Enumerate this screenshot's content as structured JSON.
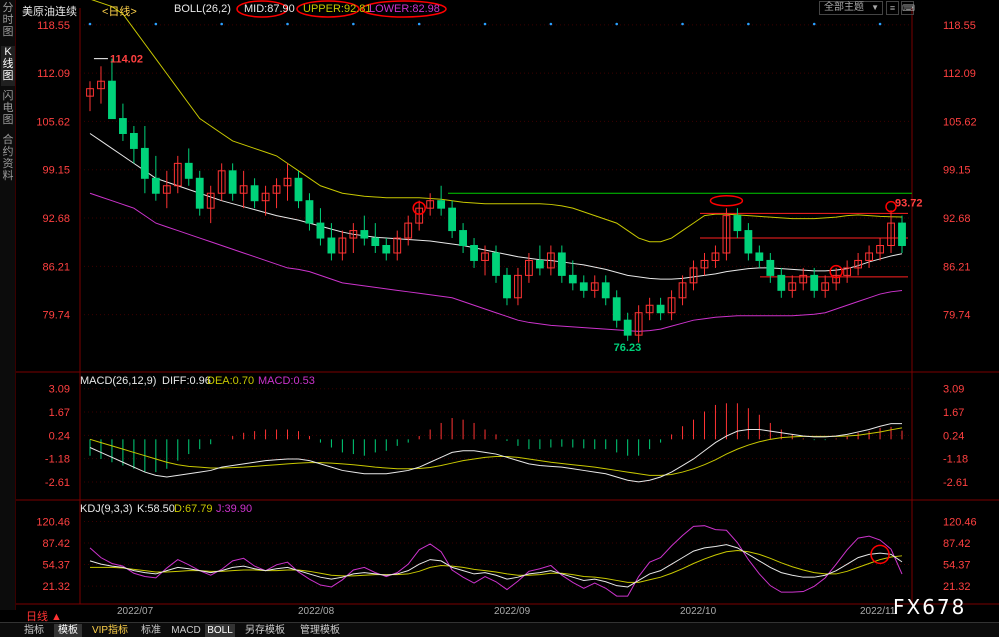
{
  "side_tabs": [
    {
      "label": "分时图",
      "active": false
    },
    {
      "label": "K线图",
      "active": true
    },
    {
      "label": "闪电图",
      "active": false
    },
    {
      "label": "合约资料",
      "active": false
    }
  ],
  "header": {
    "symbol": "美原油连续",
    "period_tag": "<日线>",
    "indicator": "BOLL(26,2)",
    "mid": "MID:87.90",
    "upper": "UPPER:92.81",
    "lower": "LOWER:82.98",
    "theme_select": "全部主题",
    "theme_arrow": "▼",
    "buttons": [
      "≡",
      "⌨"
    ]
  },
  "price_axis": [
    "118.55",
    "112.09",
    "105.62",
    "99.15",
    "92.68",
    "86.21",
    "79.74"
  ],
  "annotations": {
    "high": "114.02",
    "low": "76.23",
    "recent_high": "93.72"
  },
  "macd": {
    "title": "MACD(26,12,9)",
    "diff": "DIFF:0.96",
    "dea": "DEA:0.70",
    "macd": "MACD:0.53",
    "axis": [
      "3.09",
      "1.67",
      "0.24",
      "-1.18",
      "-2.61"
    ]
  },
  "kdj": {
    "title": "KDJ(9,3,3)",
    "k": "K:58.50",
    "d": "D:67.79",
    "j": "J:39.90",
    "axis": [
      "120.46",
      "87.42",
      "54.37",
      "21.32"
    ]
  },
  "dates": [
    "2022/07",
    "2022/08",
    "2022/09",
    "2022/10",
    "2022/11"
  ],
  "period_selector": "日线 ▲",
  "bottom_tabs": [
    {
      "label": "指标",
      "active": false
    },
    {
      "label": "模板",
      "active": true
    },
    {
      "label": "VIP指标",
      "active": false
    },
    {
      "label": "标准",
      "active": false
    },
    {
      "label": "MACD",
      "active": false
    },
    {
      "label": "BOLL",
      "active": true
    },
    {
      "label": "另存模板",
      "active": false
    },
    {
      "label": "管理模板",
      "active": false
    }
  ],
  "watermark": "FX678",
  "colors": {
    "up": "#ff3333",
    "down": "#00d27a",
    "mid": "#e8e8e8",
    "upper": "#c8c800",
    "lower": "#cc33cc",
    "dea": "#c8c800",
    "j": "#cc33cc"
  },
  "chart_data": {
    "type": "candlestick",
    "series": [
      {
        "name": "OHLC",
        "values": [
          [
            109,
            111,
            107,
            110
          ],
          [
            110,
            113,
            108,
            111
          ],
          [
            111,
            114.02,
            108,
            106
          ],
          [
            106,
            108,
            103,
            104
          ],
          [
            104,
            105,
            100,
            102
          ],
          [
            102,
            105,
            96,
            98
          ],
          [
            98,
            101,
            95,
            96
          ],
          [
            96,
            99,
            94,
            97
          ],
          [
            97,
            101,
            96,
            100
          ],
          [
            100,
            102,
            97,
            98
          ],
          [
            98,
            99,
            93,
            94
          ],
          [
            94,
            97,
            92,
            96
          ],
          [
            96,
            100,
            95,
            99
          ],
          [
            99,
            100,
            95,
            96
          ],
          [
            96,
            99,
            94,
            97
          ],
          [
            97,
            98,
            94,
            95
          ],
          [
            95,
            97,
            93,
            96
          ],
          [
            96,
            98,
            94,
            97
          ],
          [
            97,
            100,
            95,
            98
          ],
          [
            98,
            99,
            94,
            95
          ],
          [
            95,
            96,
            91,
            92
          ],
          [
            92,
            94,
            89,
            90
          ],
          [
            90,
            92,
            87,
            88
          ],
          [
            88,
            91,
            87,
            90
          ],
          [
            90,
            92,
            88,
            91
          ],
          [
            91,
            93,
            89,
            90
          ],
          [
            90,
            92,
            88,
            89
          ],
          [
            89,
            90,
            87,
            88
          ],
          [
            88,
            91,
            87,
            90
          ],
          [
            90,
            93,
            89,
            92
          ],
          [
            92,
            95,
            91,
            94
          ],
          [
            94,
            96,
            93,
            95
          ],
          [
            95,
            97,
            93,
            94
          ],
          [
            94,
            95,
            90,
            91
          ],
          [
            91,
            92,
            88,
            89
          ],
          [
            89,
            90,
            86,
            87
          ],
          [
            87,
            89,
            85,
            88
          ],
          [
            88,
            89,
            84,
            85
          ],
          [
            85,
            86,
            81,
            82
          ],
          [
            82,
            86,
            81,
            85
          ],
          [
            85,
            88,
            84,
            87
          ],
          [
            87,
            89,
            85,
            86
          ],
          [
            86,
            89,
            85,
            88
          ],
          [
            88,
            89,
            84,
            85
          ],
          [
            85,
            87,
            83,
            84
          ],
          [
            84,
            85,
            82,
            83
          ],
          [
            83,
            85,
            82,
            84
          ],
          [
            84,
            85,
            81,
            82
          ],
          [
            82,
            83,
            78,
            79
          ],
          [
            79,
            80,
            76.23,
            77
          ],
          [
            77,
            81,
            76,
            80
          ],
          [
            80,
            82,
            79,
            81
          ],
          [
            81,
            82,
            79,
            80
          ],
          [
            80,
            83,
            79,
            82
          ],
          [
            82,
            85,
            81,
            84
          ],
          [
            84,
            87,
            83,
            86
          ],
          [
            86,
            88,
            85,
            87
          ],
          [
            87,
            89,
            86,
            88
          ],
          [
            88,
            94,
            87,
            93
          ],
          [
            93,
            94,
            90,
            91
          ],
          [
            91,
            92,
            87,
            88
          ],
          [
            88,
            89,
            86,
            87
          ],
          [
            87,
            88,
            84,
            85
          ],
          [
            85,
            86,
            82,
            83
          ],
          [
            83,
            85,
            82,
            84
          ],
          [
            84,
            86,
            83,
            85
          ],
          [
            85,
            86,
            82,
            83
          ],
          [
            83,
            85,
            82,
            84
          ],
          [
            84,
            86,
            83,
            85
          ],
          [
            85,
            87,
            84,
            86
          ],
          [
            86,
            88,
            85,
            87
          ],
          [
            87,
            89,
            86,
            88
          ],
          [
            88,
            90,
            87,
            89
          ],
          [
            89,
            93.72,
            88,
            92
          ],
          [
            92,
            93,
            88,
            89
          ]
        ]
      },
      {
        "name": "MID",
        "values": [
          104,
          103,
          102,
          101,
          100,
          99,
          98,
          97.5,
          97,
          96.5,
          96,
          95.5,
          95,
          94.6,
          94.2,
          93.8,
          93.4,
          93,
          92.7,
          92.4,
          92,
          91.6,
          91.2,
          90.8,
          90.5,
          90.3,
          90.1,
          90,
          89.9,
          89.8,
          89.7,
          89.6,
          89.4,
          89.2,
          89,
          88.7,
          88.4,
          88.1,
          87.8,
          87.5,
          87.3,
          87.1,
          87,
          86.8,
          86.6,
          86.4,
          86.1,
          85.8,
          85.4,
          85,
          84.8,
          84.6,
          84.5,
          84.5,
          84.6,
          84.8,
          85,
          85.2,
          85.5,
          85.7,
          85.9,
          86,
          86,
          85.9,
          85.8,
          85.7,
          85.6,
          85.6,
          85.7,
          85.9,
          86.3,
          86.8,
          87.2,
          87.6,
          87.9
        ]
      },
      {
        "name": "UPPER",
        "values": [
          122,
          121.5,
          121,
          120,
          118,
          116,
          114,
          112,
          110,
          108,
          106,
          105,
          104,
          103,
          102.5,
          102,
          101.5,
          101,
          100,
          99,
          98,
          97,
          96.5,
          96,
          95.8,
          95.6,
          95.5,
          95.4,
          95.4,
          95.4,
          95.4,
          95.3,
          95.2,
          95,
          94.8,
          94.7,
          94.6,
          94.6,
          94.6,
          94.6,
          94.6,
          94.6,
          94.5,
          94.3,
          94,
          93.5,
          93,
          92.5,
          92,
          91,
          90,
          89.5,
          89.5,
          90,
          91,
          92,
          93,
          93.2,
          93.2,
          93.1,
          93,
          92.9,
          92.8,
          92.7,
          92.6,
          92.6,
          92.6,
          92.7,
          92.8,
          93,
          93.1,
          93,
          92.9,
          92.85,
          92.81
        ]
      },
      {
        "name": "LOWER",
        "values": [
          96,
          95.5,
          95,
          94.5,
          94,
          93,
          92,
          91.5,
          91,
          90.5,
          90,
          89.5,
          89,
          88.5,
          88,
          87.5,
          87,
          86.5,
          86,
          85.8,
          85.5,
          85,
          84.5,
          84,
          83.8,
          83.6,
          83.4,
          83.2,
          83,
          82.8,
          82.6,
          82.4,
          82.2,
          82,
          81.5,
          81,
          80.5,
          80,
          79.5,
          79,
          78.7,
          78.5,
          78.3,
          78.2,
          78.1,
          78,
          77.9,
          77.8,
          77.7,
          77.6,
          77.5,
          77.6,
          77.8,
          78.2,
          78.6,
          79,
          79.2,
          79.4,
          79.5,
          79.6,
          79.6,
          79.6,
          79.6,
          79.6,
          79.6,
          79.7,
          79.8,
          80,
          80.5,
          81,
          81.5,
          82,
          82.5,
          82.8,
          82.98
        ]
      },
      {
        "name": "DIFF",
        "values": [
          -0.5,
          -0.8,
          -1.1,
          -1.4,
          -1.7,
          -2,
          -2.2,
          -2.3,
          -2.2,
          -2.1,
          -2,
          -1.9,
          -1.7,
          -1.6,
          -1.5,
          -1.4,
          -1.3,
          -1.25,
          -1.2,
          -1.2,
          -1.3,
          -1.5,
          -1.7,
          -1.9,
          -2,
          -2.1,
          -2.1,
          -2.1,
          -2,
          -1.9,
          -1.7,
          -1.4,
          -1.1,
          -0.8,
          -0.7,
          -0.7,
          -0.8,
          -0.9,
          -1.1,
          -1.3,
          -1.5,
          -1.6,
          -1.65,
          -1.7,
          -1.8,
          -1.9,
          -2,
          -2.1,
          -2.3,
          -2.5,
          -2.6,
          -2.5,
          -2.3,
          -2,
          -1.6,
          -1.2,
          -0.7,
          -0.2,
          0.2,
          0.5,
          0.6,
          0.6,
          0.5,
          0.4,
          0.3,
          0.2,
          0.15,
          0.15,
          0.2,
          0.3,
          0.45,
          0.6,
          0.8,
          0.96,
          0.96
        ]
      },
      {
        "name": "DEA",
        "values": [
          0,
          -0.2,
          -0.4,
          -0.6,
          -0.8,
          -1,
          -1.2,
          -1.4,
          -1.55,
          -1.65,
          -1.7,
          -1.75,
          -1.75,
          -1.73,
          -1.7,
          -1.65,
          -1.6,
          -1.55,
          -1.5,
          -1.45,
          -1.42,
          -1.42,
          -1.45,
          -1.5,
          -1.55,
          -1.62,
          -1.7,
          -1.75,
          -1.8,
          -1.8,
          -1.78,
          -1.72,
          -1.6,
          -1.45,
          -1.3,
          -1.2,
          -1.1,
          -1.05,
          -1.05,
          -1.1,
          -1.2,
          -1.3,
          -1.4,
          -1.48,
          -1.55,
          -1.62,
          -1.7,
          -1.8,
          -1.9,
          -2,
          -2.1,
          -2.2,
          -2.2,
          -2.15,
          -2,
          -1.8,
          -1.55,
          -1.25,
          -0.9,
          -0.6,
          -0.35,
          -0.15,
          0,
          0.1,
          0.15,
          0.18,
          0.18,
          0.18,
          0.18,
          0.2,
          0.25,
          0.35,
          0.45,
          0.58,
          0.7
        ]
      },
      {
        "name": "MACD",
        "values": [
          -1,
          -1.2,
          -1.4,
          -1.6,
          -1.8,
          -2,
          -2,
          -1.8,
          -1.3,
          -0.9,
          -0.6,
          -0.3,
          0,
          0.2,
          0.4,
          0.5,
          0.6,
          0.6,
          0.6,
          0.5,
          0.2,
          -0.2,
          -0.5,
          -0.8,
          -0.9,
          -1,
          -0.8,
          -0.7,
          -0.4,
          -0.2,
          0.2,
          0.6,
          1,
          1.3,
          1.2,
          1,
          0.6,
          0.3,
          -0.1,
          -0.4,
          -0.6,
          -0.6,
          -0.5,
          -0.45,
          -0.5,
          -0.55,
          -0.6,
          -0.6,
          -0.8,
          -1,
          -1,
          -0.6,
          -0.2,
          0.3,
          0.8,
          1.2,
          1.7,
          2.1,
          2.2,
          2.2,
          1.9,
          1.5,
          1,
          0.6,
          0.3,
          0.05,
          -0.05,
          -0.05,
          0.05,
          0.2,
          0.4,
          0.5,
          0.7,
          0.76,
          0.53
        ]
      },
      {
        "name": "K",
        "values": [
          60,
          55,
          52,
          50,
          45,
          42,
          40,
          45,
          50,
          48,
          45,
          42,
          45,
          50,
          52,
          48,
          45,
          48,
          50,
          45,
          40,
          35,
          32,
          35,
          40,
          42,
          40,
          38,
          40,
          45,
          55,
          62,
          60,
          50,
          45,
          40,
          42,
          38,
          32,
          35,
          40,
          42,
          45,
          40,
          35,
          30,
          32,
          28,
          22,
          20,
          30,
          40,
          45,
          55,
          65,
          75,
          80,
          82,
          85,
          80,
          70,
          60,
          50,
          42,
          38,
          35,
          35,
          38,
          45,
          55,
          65,
          70,
          72,
          70,
          58.5
        ]
      },
      {
        "name": "D",
        "values": [
          50,
          50,
          50,
          49,
          47,
          45,
          43,
          43,
          44,
          45,
          45,
          44,
          44,
          45,
          46,
          46,
          45,
          45,
          46,
          46,
          44,
          41,
          38,
          37,
          37,
          38,
          39,
          39,
          39,
          40,
          44,
          50,
          53,
          52,
          50,
          47,
          45,
          43,
          40,
          38,
          38,
          39,
          41,
          41,
          39,
          36,
          35,
          33,
          30,
          27,
          27,
          31,
          35,
          41,
          48,
          56,
          63,
          69,
          74,
          76,
          74,
          70,
          64,
          57,
          51,
          46,
          42,
          40,
          40,
          44,
          50,
          56,
          62,
          66,
          67.79
        ]
      },
      {
        "name": "J",
        "values": [
          80,
          65,
          56,
          52,
          41,
          36,
          34,
          49,
          62,
          54,
          45,
          38,
          47,
          60,
          64,
          52,
          45,
          54,
          58,
          43,
          32,
          23,
          20,
          31,
          46,
          50,
          42,
          36,
          42,
          55,
          77,
          86,
          74,
          46,
          35,
          26,
          36,
          28,
          16,
          29,
          44,
          48,
          53,
          38,
          27,
          18,
          26,
          18,
          6,
          6,
          36,
          58,
          65,
          83,
          99,
          113,
          114,
          108,
          107,
          88,
          62,
          40,
          22,
          12,
          12,
          13,
          21,
          34,
          55,
          77,
          95,
          98,
          92,
          78,
          39.9
        ]
      }
    ],
    "x_labels": [
      "2022/07",
      "2022/08",
      "2022/09",
      "2022/10",
      "2022/11"
    ],
    "ylim": [
      73,
      120
    ],
    "macd_ylim": [
      -3.4,
      3.5
    ],
    "kdj_ylim": [
      0,
      135
    ],
    "grid": true,
    "legend": "top-left"
  }
}
